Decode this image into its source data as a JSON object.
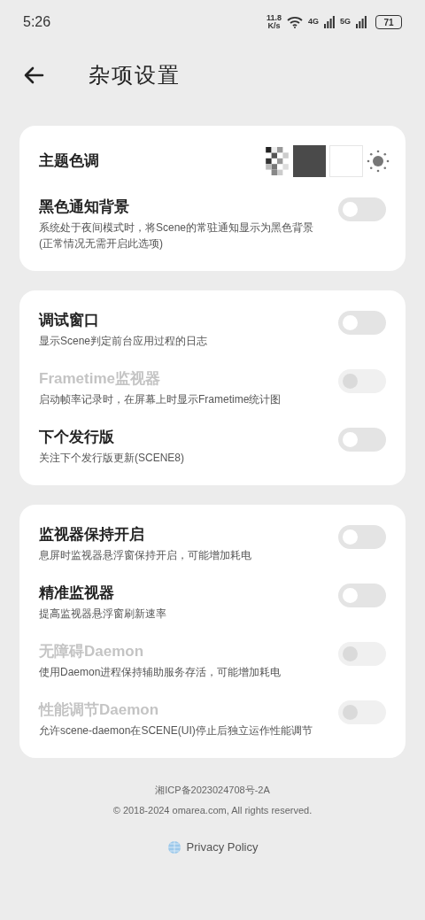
{
  "status_bar": {
    "time": "5:26",
    "speed": "11.8",
    "speed_unit": "K/s",
    "network_1": "4G",
    "network_2": "5G",
    "battery": "71"
  },
  "header": {
    "title": "杂项设置"
  },
  "theme": {
    "label": "主题色调",
    "options": [
      {
        "kind": "transparent"
      },
      {
        "kind": "dark"
      },
      {
        "kind": "light"
      },
      {
        "kind": "auto"
      }
    ]
  },
  "groups": [
    {
      "settings": [
        {
          "title": "黑色通知背景",
          "description": "系统处于夜间模式时，将Scene的常驻通知显示为黑色背景(正常情况无需开启此选项)",
          "on": false,
          "disabled": false
        }
      ]
    },
    {
      "settings": [
        {
          "title": "调试窗口",
          "description": "显示Scene判定前台应用过程的日志",
          "on": false,
          "disabled": false
        },
        {
          "title": "Frametime监视器",
          "description": "启动帧率记录时，在屏幕上时显示Frametime统计图",
          "on": false,
          "disabled": true
        },
        {
          "title": "下个发行版",
          "description": "关注下个发行版更新(SCENE8)",
          "on": false,
          "disabled": false
        }
      ]
    },
    {
      "settings": [
        {
          "title": "监视器保持开启",
          "description": "息屏时监视器悬浮窗保持开启，可能增加耗电",
          "on": false,
          "disabled": false
        },
        {
          "title": "精准监视器",
          "description": "提高监视器悬浮窗刷新速率",
          "on": false,
          "disabled": false
        },
        {
          "title": "无障碍Daemon",
          "description": "使用Daemon进程保持辅助服务存活，可能增加耗电",
          "on": false,
          "disabled": true
        },
        {
          "title": "性能调节Daemon",
          "description": "允许scene-daemon在SCENE(UI)停止后独立运作性能调节",
          "on": false,
          "disabled": true
        }
      ]
    }
  ],
  "footer": {
    "icp": "湘ICP备2023024708号-2A",
    "copyright": "© 2018-2024 omarea.com, All rights reserved.",
    "privacy_link": "Privacy Policy"
  }
}
